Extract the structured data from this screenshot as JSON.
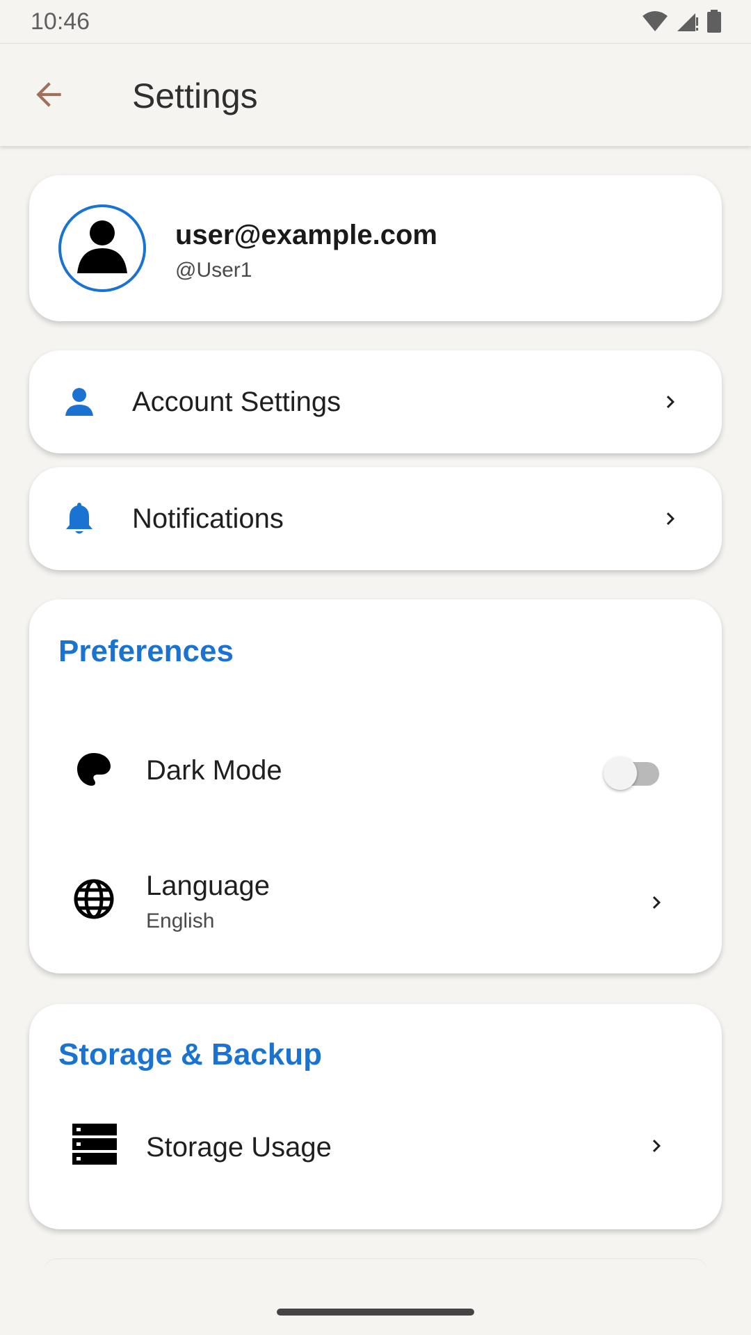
{
  "status_bar": {
    "time": "10:46"
  },
  "header": {
    "title": "Settings"
  },
  "profile": {
    "email": "user@example.com",
    "handle": "@User1"
  },
  "nav_items": [
    {
      "label": "Account Settings",
      "icon": "person-icon"
    },
    {
      "label": "Notifications",
      "icon": "bell-icon"
    }
  ],
  "preferences": {
    "title": "Preferences",
    "dark_mode": {
      "label": "Dark Mode",
      "enabled": false
    },
    "language": {
      "label": "Language",
      "value": "English"
    }
  },
  "storage": {
    "title": "Storage & Backup",
    "usage_label": "Storage Usage"
  },
  "colors": {
    "accent": "#1a73d1",
    "back_arrow": "#a0705a",
    "background": "#f5f4f1"
  }
}
